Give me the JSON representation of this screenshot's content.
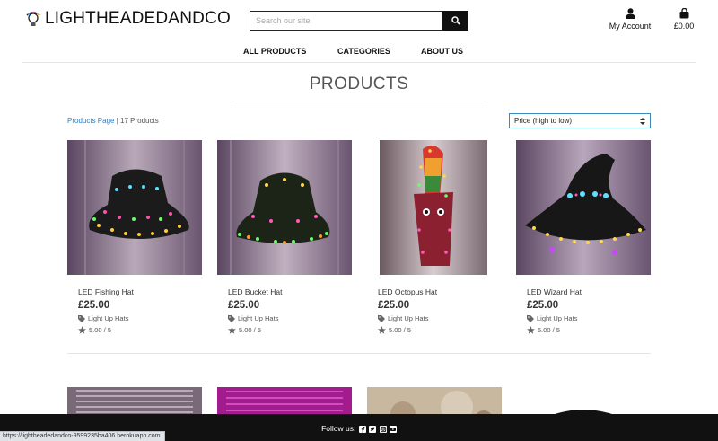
{
  "header": {
    "logo_text": "LIGHTHEADEDANDCO",
    "search_placeholder": "Search our site",
    "account_label": "My Account",
    "bag_total": "£0.00"
  },
  "nav": {
    "items": [
      "ALL PRODUCTS",
      "CATEGORIES",
      "ABOUT US"
    ]
  },
  "page": {
    "title": "PRODUCTS",
    "breadcrumb_link": "Products Page",
    "breadcrumb_count": " | 17 Products",
    "sort_selected": "Price (high to low)"
  },
  "products": [
    {
      "name": "LED Fishing Hat",
      "price": "£25.00",
      "category": "Light Up Hats",
      "rating": "5.00 / 5"
    },
    {
      "name": "LED Bucket Hat",
      "price": "£25.00",
      "category": "Light Up Hats",
      "rating": "5.00 / 5"
    },
    {
      "name": "LED Octopus Hat",
      "price": "£25.00",
      "category": "Light Up Hats",
      "rating": "5.00 / 5"
    },
    {
      "name": "LED Wizard Hat",
      "price": "£25.00",
      "category": "Light Up Hats",
      "rating": "5.00 / 5"
    }
  ],
  "footer": {
    "follow_label": "Follow us:"
  },
  "status_url": "https://lightheadedandco-9599235ba406.herokuapp.com"
}
